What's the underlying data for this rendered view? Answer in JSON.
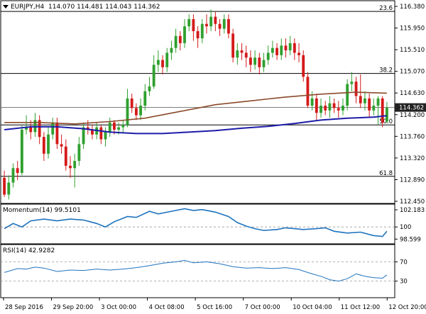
{
  "header": {
    "symbol": "EURJPY,H4",
    "ohlc": "114.070 114.481 114.043 114.362"
  },
  "colors": {
    "bull": "#2fa02f",
    "bear": "#d41a1a",
    "ma_slow": "#8b4a2b",
    "ma_fast": "#1c1ca8",
    "indicator": "#1e73be",
    "price_box": "#222222",
    "grid_level": "#000000"
  },
  "chart_data": [
    {
      "type": "candlestick",
      "title": "EURJPY,H4",
      "ylim": [
        112.44,
        116.48
      ],
      "y_ticks": [
        "116.380",
        "115.950",
        "115.510",
        "115.070",
        "114.630",
        "114.200",
        "113.760",
        "113.320",
        "112.890",
        "112.450"
      ],
      "current_price": "114.362",
      "fib_levels": [
        {
          "label": "23.6",
          "value": 116.36
        },
        {
          "label": "38.2",
          "value": 115.07
        },
        {
          "label": "50.0",
          "value": 114.0
        },
        {
          "label": "61.8",
          "value": 112.93
        }
      ],
      "x_labels": [
        "28 Sep 2016",
        "29 Sep 20:00",
        "3 Oct 00:00",
        "4 Oct 08:00",
        "5 Oct 16:00",
        "7 Oct 00:00",
        "10 Oct 04:00",
        "11 Oct 12:00",
        "12 Oct 20:00"
      ],
      "candles": [
        [
          112.9,
          112.55,
          113.05,
          112.5
        ],
        [
          112.55,
          112.8,
          112.95,
          112.45
        ],
        [
          112.8,
          113.1,
          113.2,
          112.7
        ],
        [
          113.1,
          113.0,
          113.25,
          112.85
        ],
        [
          113.0,
          113.9,
          114.0,
          112.95
        ],
        [
          113.9,
          113.95,
          114.2,
          113.8
        ],
        [
          113.95,
          113.85,
          114.1,
          113.7
        ],
        [
          113.85,
          114.1,
          114.25,
          113.75
        ],
        [
          114.1,
          113.75,
          114.2,
          113.6
        ],
        [
          113.75,
          113.4,
          113.85,
          113.25
        ],
        [
          113.4,
          113.8,
          113.95,
          113.3
        ],
        [
          113.8,
          114.05,
          114.15,
          113.7
        ],
        [
          114.05,
          113.6,
          114.15,
          113.5
        ],
        [
          113.6,
          113.55,
          113.8,
          113.4
        ],
        [
          113.55,
          113.15,
          113.7,
          113.05
        ],
        [
          113.15,
          113.1,
          113.35,
          112.9
        ],
        [
          113.1,
          113.25,
          113.4,
          112.7
        ],
        [
          113.25,
          113.6,
          113.75,
          113.15
        ],
        [
          113.6,
          113.95,
          114.05,
          113.5
        ],
        [
          113.95,
          113.9,
          114.1,
          113.8
        ],
        [
          113.9,
          113.8,
          114.0,
          113.7
        ],
        [
          113.8,
          113.95,
          114.05,
          113.7
        ],
        [
          113.95,
          113.7,
          114.0,
          113.6
        ],
        [
          113.7,
          113.85,
          113.95,
          113.55
        ],
        [
          113.85,
          114.05,
          114.15,
          113.75
        ],
        [
          114.05,
          113.9,
          114.1,
          113.8
        ],
        [
          113.9,
          113.95,
          114.05,
          113.8
        ],
        [
          113.95,
          114.0,
          114.1,
          113.85
        ],
        [
          114.0,
          114.55,
          114.75,
          113.95
        ],
        [
          114.55,
          114.35,
          114.65,
          114.25
        ],
        [
          114.35,
          114.2,
          114.45,
          114.1
        ],
        [
          114.2,
          114.4,
          114.55,
          114.1
        ],
        [
          114.4,
          114.7,
          114.85,
          114.3
        ],
        [
          114.7,
          114.8,
          115.0,
          114.6
        ],
        [
          114.8,
          115.25,
          115.45,
          114.75
        ],
        [
          115.25,
          115.35,
          115.55,
          115.1
        ],
        [
          115.35,
          115.2,
          115.45,
          115.05
        ],
        [
          115.2,
          115.5,
          115.6,
          115.1
        ],
        [
          115.5,
          115.6,
          115.75,
          115.35
        ],
        [
          115.6,
          115.85,
          116.0,
          115.5
        ],
        [
          115.85,
          115.7,
          115.95,
          115.55
        ],
        [
          115.7,
          116.05,
          116.2,
          115.6
        ],
        [
          116.05,
          116.2,
          116.3,
          115.95
        ],
        [
          116.2,
          115.95,
          116.3,
          115.75
        ],
        [
          115.95,
          115.8,
          116.05,
          115.6
        ],
        [
          115.8,
          116.1,
          116.2,
          115.7
        ],
        [
          116.1,
          116.05,
          116.3,
          115.9
        ],
        [
          116.05,
          116.25,
          116.4,
          115.95
        ],
        [
          116.25,
          116.1,
          116.35,
          115.95
        ],
        [
          116.1,
          116.0,
          116.2,
          115.85
        ],
        [
          116.0,
          116.2,
          116.3,
          115.9
        ],
        [
          116.2,
          115.9,
          116.3,
          115.8
        ],
        [
          115.9,
          115.4,
          116.0,
          115.3
        ],
        [
          115.4,
          115.55,
          115.7,
          115.25
        ],
        [
          115.55,
          115.5,
          115.7,
          115.35
        ],
        [
          115.5,
          115.4,
          115.65,
          115.2
        ],
        [
          115.4,
          115.25,
          115.55,
          115.1
        ],
        [
          115.25,
          115.4,
          115.55,
          115.15
        ],
        [
          115.4,
          115.2,
          115.5,
          115.05
        ],
        [
          115.2,
          115.35,
          115.5,
          115.1
        ],
        [
          115.35,
          115.5,
          115.65,
          115.25
        ],
        [
          115.5,
          115.6,
          115.75,
          115.4
        ],
        [
          115.6,
          115.45,
          115.7,
          115.35
        ],
        [
          115.45,
          115.65,
          115.8,
          115.35
        ],
        [
          115.65,
          115.55,
          115.8,
          115.4
        ],
        [
          115.55,
          115.7,
          115.85,
          115.45
        ],
        [
          115.7,
          115.5,
          115.8,
          115.35
        ],
        [
          115.5,
          115.45,
          115.7,
          115.3
        ],
        [
          115.45,
          115.0,
          115.55,
          114.9
        ],
        [
          115.0,
          114.4,
          115.1,
          114.35
        ],
        [
          114.4,
          114.55,
          114.7,
          114.3
        ],
        [
          114.55,
          114.25,
          114.65,
          114.1
        ],
        [
          114.25,
          114.4,
          114.55,
          114.15
        ],
        [
          114.4,
          114.3,
          114.5,
          114.2
        ],
        [
          114.3,
          114.45,
          114.6,
          114.15
        ],
        [
          114.45,
          114.35,
          114.55,
          114.25
        ],
        [
          114.35,
          114.3,
          114.5,
          114.15
        ],
        [
          114.3,
          114.4,
          114.55,
          114.2
        ],
        [
          114.4,
          114.85,
          114.95,
          114.3
        ],
        [
          114.85,
          114.9,
          115.1,
          114.7
        ],
        [
          114.9,
          114.6,
          115.0,
          114.45
        ],
        [
          114.6,
          114.45,
          115.05,
          114.35
        ],
        [
          114.45,
          114.55,
          114.7,
          114.3
        ],
        [
          114.55,
          114.3,
          114.65,
          114.15
        ],
        [
          114.3,
          114.4,
          114.55,
          114.2
        ],
        [
          114.4,
          114.55,
          114.6,
          114.0
        ],
        [
          114.55,
          114.05,
          114.6,
          113.95
        ],
        [
          114.07,
          114.36,
          114.48,
          114.04
        ]
      ],
      "ma_slow": [
        [
          0,
          114.05
        ],
        [
          8,
          114.05
        ],
        [
          16,
          114.02
        ],
        [
          24,
          114.07
        ],
        [
          32,
          114.14
        ],
        [
          40,
          114.28
        ],
        [
          48,
          114.42
        ],
        [
          56,
          114.5
        ],
        [
          64,
          114.58
        ],
        [
          72,
          114.64
        ],
        [
          80,
          114.68
        ],
        [
          87,
          114.66
        ]
      ],
      "ma_fast": [
        [
          0,
          113.9
        ],
        [
          6,
          113.96
        ],
        [
          12,
          113.96
        ],
        [
          18,
          113.92
        ],
        [
          24,
          113.85
        ],
        [
          30,
          113.82
        ],
        [
          36,
          113.82
        ],
        [
          42,
          113.85
        ],
        [
          48,
          113.88
        ],
        [
          54,
          113.93
        ],
        [
          60,
          113.97
        ],
        [
          66,
          114.03
        ],
        [
          72,
          114.1
        ],
        [
          78,
          114.14
        ],
        [
          84,
          114.16
        ],
        [
          87,
          114.19
        ]
      ]
    },
    {
      "type": "line",
      "title": "Momentum(14) 99.5101",
      "ylim": [
        98.3,
        102.3
      ],
      "y_ticks": [
        "102.183",
        "100",
        "98.599"
      ],
      "reference_level": 100,
      "values": [
        [
          0,
          99.8
        ],
        [
          2,
          100.4
        ],
        [
          4,
          100.0
        ],
        [
          6,
          100.7
        ],
        [
          9,
          100.9
        ],
        [
          12,
          100.7
        ],
        [
          15,
          100.9
        ],
        [
          18,
          100.8
        ],
        [
          21,
          100.4
        ],
        [
          23,
          100.0
        ],
        [
          25,
          100.6
        ],
        [
          28,
          101.2
        ],
        [
          30,
          101.1
        ],
        [
          33,
          101.8
        ],
        [
          35,
          101.5
        ],
        [
          38,
          101.8
        ],
        [
          41,
          102.1
        ],
        [
          43,
          101.9
        ],
        [
          45,
          102.0
        ],
        [
          48,
          101.7
        ],
        [
          51,
          101.2
        ],
        [
          53,
          100.5
        ],
        [
          55,
          100.1
        ],
        [
          57,
          99.8
        ],
        [
          59,
          99.6
        ],
        [
          62,
          99.7
        ],
        [
          64,
          99.9
        ],
        [
          66,
          99.8
        ],
        [
          68,
          99.7
        ],
        [
          71,
          99.8
        ],
        [
          73,
          99.9
        ],
        [
          75,
          99.5
        ],
        [
          78,
          99.3
        ],
        [
          81,
          99.4
        ],
        [
          84,
          99.0
        ],
        [
          86,
          98.9
        ],
        [
          87,
          99.5
        ]
      ]
    },
    {
      "type": "line",
      "title": "RSI(14) 42.9282",
      "ylim": [
        0,
        100
      ],
      "y_ticks": [
        "70",
        "30"
      ],
      "reference_levels": [
        70,
        30
      ],
      "values": [
        [
          0,
          48
        ],
        [
          3,
          56
        ],
        [
          5,
          55
        ],
        [
          7,
          59
        ],
        [
          9,
          57
        ],
        [
          12,
          50
        ],
        [
          15,
          53
        ],
        [
          18,
          52
        ],
        [
          21,
          55
        ],
        [
          24,
          53
        ],
        [
          27,
          55
        ],
        [
          30,
          58
        ],
        [
          33,
          62
        ],
        [
          36,
          67
        ],
        [
          39,
          70
        ],
        [
          41,
          73
        ],
        [
          43,
          68
        ],
        [
          46,
          70
        ],
        [
          49,
          66
        ],
        [
          52,
          60
        ],
        [
          55,
          57
        ],
        [
          58,
          58
        ],
        [
          61,
          56
        ],
        [
          64,
          58
        ],
        [
          67,
          54
        ],
        [
          70,
          45
        ],
        [
          72,
          40
        ],
        [
          74,
          33
        ],
        [
          76,
          30
        ],
        [
          78,
          35
        ],
        [
          80,
          45
        ],
        [
          82,
          40
        ],
        [
          84,
          37
        ],
        [
          86,
          36
        ],
        [
          87,
          43
        ]
      ]
    }
  ]
}
